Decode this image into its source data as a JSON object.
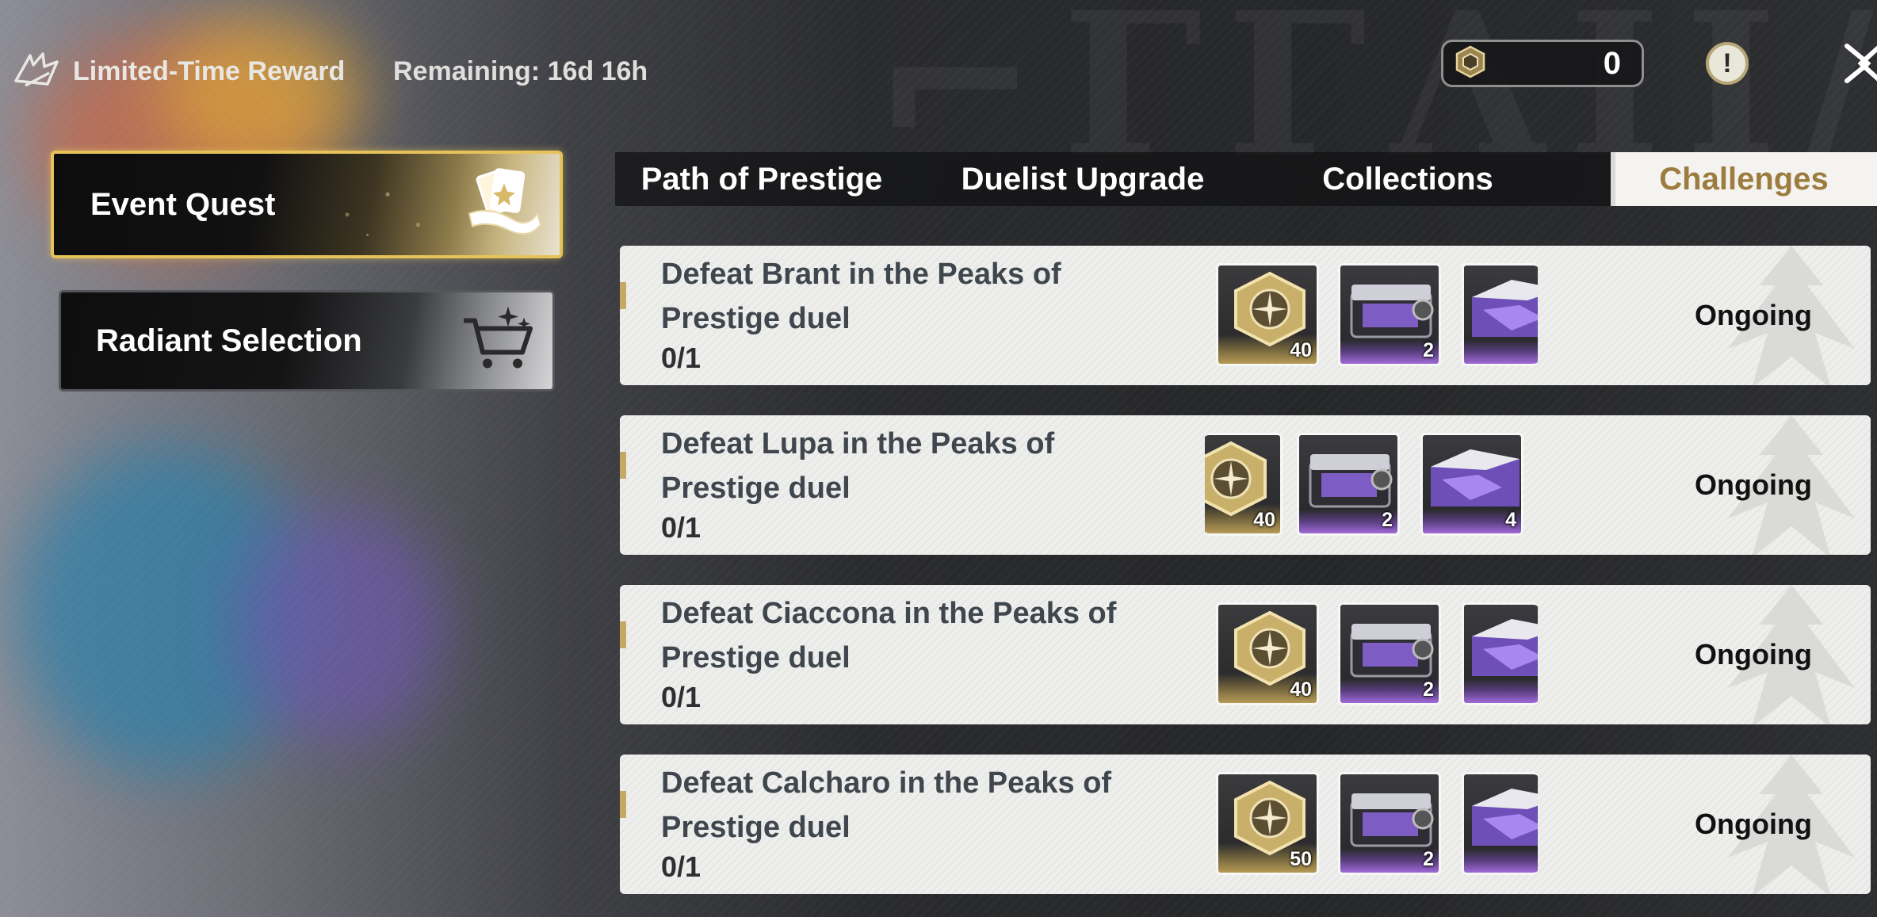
{
  "header": {
    "title": "Limited-Time Reward",
    "remaining": "Remaining: 16d 16h",
    "currency_value": "0"
  },
  "sidebar": {
    "items": [
      {
        "label": "Event Quest",
        "active": true,
        "icon": "scroll-cards-icon"
      },
      {
        "label": "Radiant Selection",
        "active": false,
        "icon": "shopping-cart-icon"
      }
    ]
  },
  "tabs": [
    {
      "label": "Path of Prestige",
      "active": false
    },
    {
      "label": "Duelist Upgrade",
      "active": false
    },
    {
      "label": "Collections",
      "active": false
    },
    {
      "label": "Challenges",
      "active": true
    }
  ],
  "quests": [
    {
      "title_line1": "Defeat Brant in the Peaks of",
      "title_line2": "Prestige duel",
      "progress": "0/1",
      "status": "Ongoing",
      "rewards": [
        {
          "type": "gold-emblem",
          "count": "40"
        },
        {
          "type": "purple-crate",
          "count": "2"
        },
        {
          "type": "purple-crystal-chest",
          "count": ""
        }
      ]
    },
    {
      "title_line1": "Defeat Lupa in the Peaks of",
      "title_line2": "Prestige duel",
      "progress": "0/1",
      "status": "Ongoing",
      "rewards": [
        {
          "type": "gold-emblem",
          "count": "40"
        },
        {
          "type": "purple-crate",
          "count": "2"
        },
        {
          "type": "purple-crystal-chest",
          "count": "4"
        }
      ]
    },
    {
      "title_line1": "Defeat Ciaccona in the Peaks of",
      "title_line2": "Prestige duel",
      "progress": "0/1",
      "status": "Ongoing",
      "rewards": [
        {
          "type": "gold-emblem",
          "count": "40"
        },
        {
          "type": "purple-crate",
          "count": "2"
        },
        {
          "type": "purple-crystal-chest",
          "count": ""
        }
      ]
    },
    {
      "title_line1": "Defeat Calcharo in the Peaks of",
      "title_line2": "Prestige duel",
      "progress": "0/1",
      "status": "Ongoing",
      "rewards": [
        {
          "type": "gold-emblem",
          "count": "50"
        },
        {
          "type": "purple-crate",
          "count": "2"
        },
        {
          "type": "purple-crystal-chest",
          "count": ""
        }
      ]
    }
  ],
  "colors": {
    "accent_gold": "#e6c35a",
    "active_tab_text": "#9c7d3f",
    "quest_title": "#3f464d"
  }
}
